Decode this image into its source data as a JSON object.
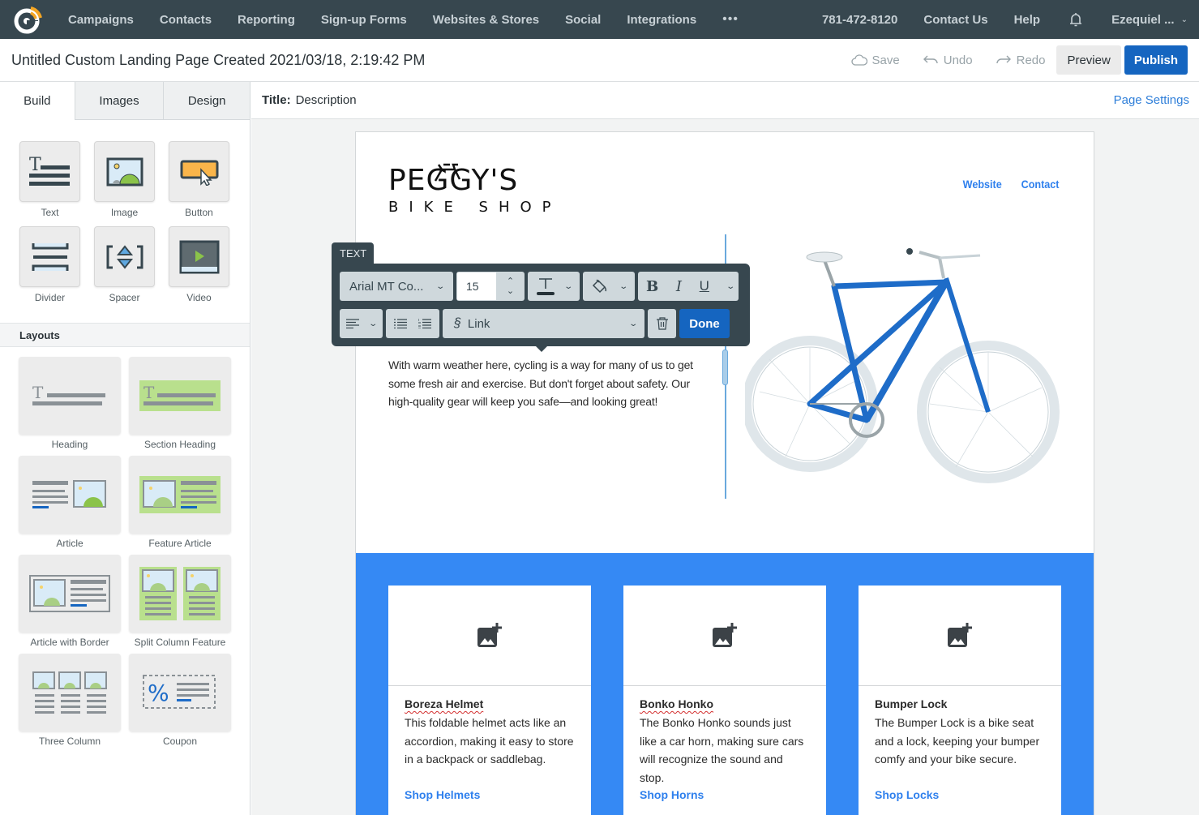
{
  "topnav": {
    "logo": "constant-contact-logo",
    "items": [
      "Campaigns",
      "Contacts",
      "Reporting",
      "Sign-up Forms",
      "Websites & Stores",
      "Social",
      "Integrations"
    ],
    "more": "•••",
    "phone": "781-472-8120",
    "contact_us": "Contact Us",
    "help": "Help",
    "user": "Ezequiel ..."
  },
  "titlebar": {
    "title": "Untitled Custom Landing Page Created 2021/03/18, 2:19:42 PM",
    "save": "Save",
    "undo": "Undo",
    "redo": "Redo",
    "preview": "Preview",
    "publish": "Publish"
  },
  "sidebar": {
    "tabs": [
      "Build",
      "Images",
      "Design"
    ],
    "active_tab": "Build",
    "blocks": [
      {
        "label": "Text",
        "icon": "text-block-icon"
      },
      {
        "label": "Image",
        "icon": "image-block-icon"
      },
      {
        "label": "Button",
        "icon": "button-block-icon"
      },
      {
        "label": "Divider",
        "icon": "divider-block-icon"
      },
      {
        "label": "Spacer",
        "icon": "spacer-block-icon"
      },
      {
        "label": "Video",
        "icon": "video-block-icon"
      }
    ],
    "layouts_heading": "Layouts",
    "layouts": [
      {
        "label": "Heading"
      },
      {
        "label": "Section Heading"
      },
      {
        "label": "Article"
      },
      {
        "label": "Feature Article"
      },
      {
        "label": "Article with Border"
      },
      {
        "label": "Split Column Feature"
      },
      {
        "label": "Three Column"
      },
      {
        "label": "Coupon"
      }
    ]
  },
  "main": {
    "title_label": "Title:",
    "title_value": "Description",
    "page_settings": "Page Settings"
  },
  "page": {
    "brand_line1": "PEGGY'S",
    "brand_line2": "BIKE SHOP",
    "links": [
      "Website",
      "Contact"
    ],
    "body_text": "With warm weather here, cycling is a way for many of us to get some fresh air and exercise. But don't forget about safety. Our high-quality gear will keep you safe—and looking great!",
    "accent_color": "#3589f4",
    "cards": [
      {
        "title": "Boreza Helmet",
        "desc": "This foldable helmet acts like an accordion, making it easy to store in a backpack or saddlebag.",
        "link": "Shop Helmets"
      },
      {
        "title": "Bonko Honko",
        "desc": "The Bonko Honko sounds just like a car horn, making sure cars will recognize the sound and stop.",
        "link": "Shop Horns"
      },
      {
        "title": "Bumper Lock",
        "desc": "The Bumper Lock is a bike seat and a lock, keeping your bumper comfy and your bike secure.",
        "link": "Shop Locks"
      }
    ]
  },
  "text_toolbar": {
    "tag": "TEXT",
    "font": "Arial MT Co...",
    "size": "15",
    "link": "Link",
    "done": "Done"
  }
}
